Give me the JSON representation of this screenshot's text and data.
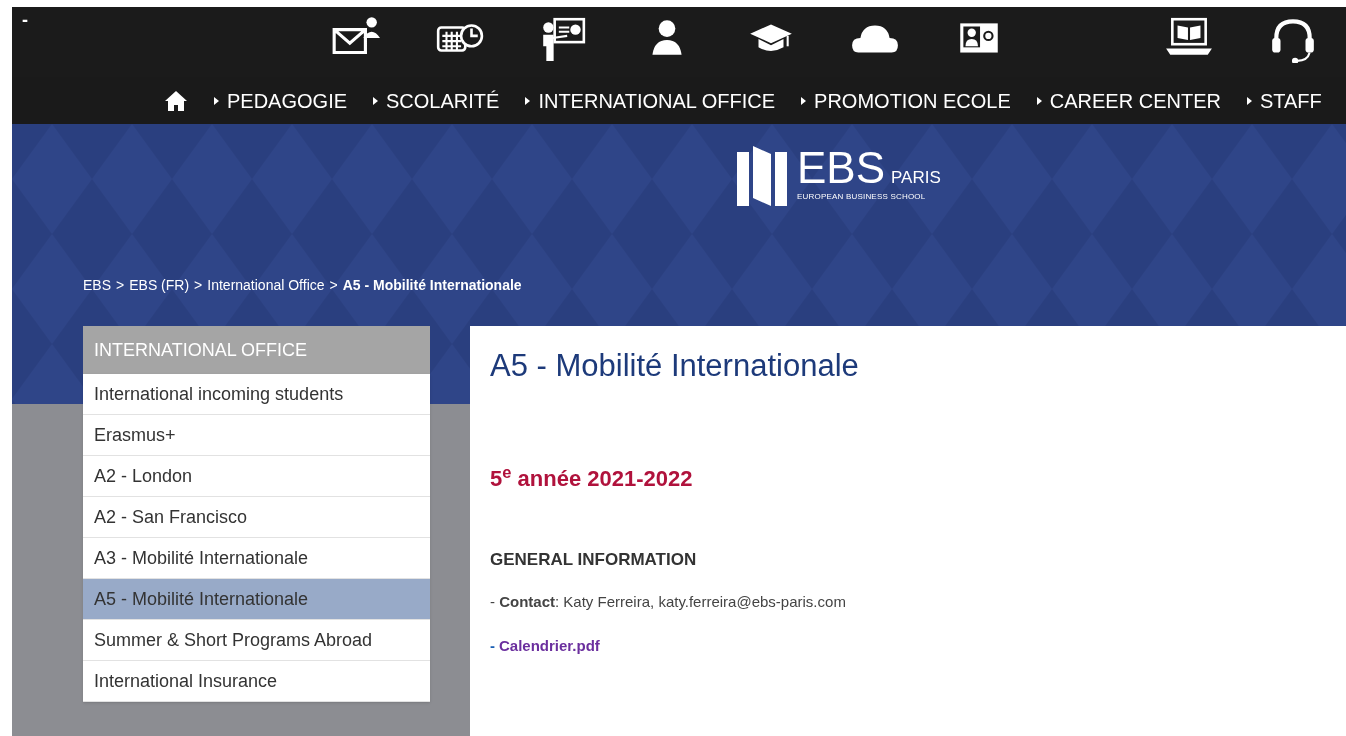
{
  "top_bar": {
    "menu_toggle": "-"
  },
  "nav": {
    "items": [
      {
        "label": "PEDAGOGIE"
      },
      {
        "label": "SCOLARITÉ"
      },
      {
        "label": "INTERNATIONAL OFFICE"
      },
      {
        "label": "PROMOTION ECOLE"
      },
      {
        "label": "CAREER CENTER"
      },
      {
        "label": "STAFF"
      }
    ]
  },
  "logo": {
    "name": "EBS",
    "city": "PARIS",
    "tagline": "EUROPEAN BUSINESS SCHOOL"
  },
  "breadcrumb": [
    {
      "kind": "link",
      "text": "EBS"
    },
    {
      "kind": "separator",
      "text": ">"
    },
    {
      "kind": "link",
      "text": "EBS (FR)"
    },
    {
      "kind": "separator",
      "text": ">"
    },
    {
      "kind": "link",
      "text": "International Office"
    },
    {
      "kind": "separator",
      "text": ">"
    },
    {
      "kind": "current",
      "text": "A5 - Mobilité Internationale"
    }
  ],
  "sidebar": {
    "title": "INTERNATIONAL OFFICE",
    "items": [
      {
        "label": "International incoming students",
        "selected": false
      },
      {
        "label": "Erasmus+",
        "selected": false
      },
      {
        "label": "A2 - London",
        "selected": false
      },
      {
        "label": "A2 - San Francisco",
        "selected": false
      },
      {
        "label": "A3 - Mobilité Internationale",
        "selected": false
      },
      {
        "label": "A5 - Mobilité Internationale",
        "selected": true
      },
      {
        "label": "Summer & Short Programs Abroad",
        "selected": false
      },
      {
        "label": "International Insurance",
        "selected": false
      }
    ]
  },
  "content": {
    "title": "A5 - Mobilité Internationale",
    "subtitle": "5$^{e}$ année 2021-2022",
    "section_heading": "GENERAL INFORMATION",
    "contact": "- **Contact**: Katy Ferreira, katy.ferreira@ebs-paris.com",
    "link": {
      "dash": "-",
      "label": "Calendrier.pdf"
    }
  }
}
